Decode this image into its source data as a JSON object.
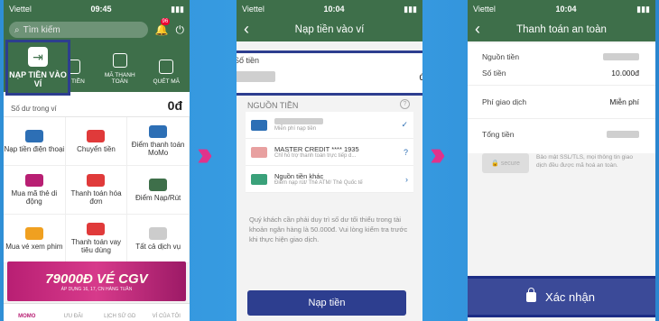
{
  "screen1": {
    "carrier": "Viettel",
    "time": "09:45",
    "battery": "▮▮▮",
    "search_placeholder": "Tìm kiếm",
    "badge": "96",
    "highlight_label": "NẠP TIỀN VÀO VÍ",
    "quick_actions": [
      {
        "label": ""
      },
      {
        "label": "ÚT TIỀN"
      },
      {
        "label": "MÃ THANH TOÁN"
      },
      {
        "label": "QUÉT MÃ"
      }
    ],
    "balance_label": "Số dư trong ví",
    "balance_value": "0đ",
    "services": [
      {
        "label": "Nạp tiền điện thoại",
        "color": "#2d6fb5"
      },
      {
        "label": "Chuyển tiền",
        "color": "#e03a3a"
      },
      {
        "label": "Điểm thanh toán MoMo",
        "color": "#2d6fb5"
      },
      {
        "label": "Mua mã thẻ di động",
        "color": "#b81f73"
      },
      {
        "label": "Thanh toán hóa đơn",
        "color": "#e03a3a"
      },
      {
        "label": "Điểm Nạp/Rút",
        "color": "#3e6f4a"
      },
      {
        "label": "Mua vé xem phim",
        "color": "#f0a020"
      },
      {
        "label": "Thanh toán vay tiêu dùng",
        "color": "#e03a3a"
      },
      {
        "label": "Tất cả dịch vụ",
        "color": "#cccccc"
      }
    ],
    "promo_big": "79000Đ VÉ CGV",
    "promo_small": "ÁP DỤNG 16, 17, CN HÀNG TUẦN",
    "tabs": [
      "MOMO",
      "ƯU ĐÃI",
      "LỊCH SỬ GD",
      "VÍ CỦA TÔI"
    ]
  },
  "screen2": {
    "carrier": "Viettel",
    "time": "10:04",
    "title": "Nạp tiền vào ví",
    "amount_label": "Số tiền",
    "currency": "đ",
    "sources_label": "NGUỒN TIỀN",
    "sources": [
      {
        "name": "",
        "sub": "Miễn phí nạp tiền",
        "mark": "✓",
        "color": "#2d6fb5"
      },
      {
        "name": "MASTER CREDIT **** 1935",
        "sub": "Chỉ hỗ trợ thanh toán trực tiếp d...",
        "mark": "?",
        "color": "#e8a0a0"
      },
      {
        "name": "Nguồn tiền khác",
        "sub": "Điểm nạp rút/ Thẻ ATM/ Thẻ Quốc tế",
        "mark": "›",
        "color": "#3aa17a"
      }
    ],
    "notice": "Quý khách cần phải duy trì số dư tối thiểu trong tài khoản ngân hàng là 50.000đ. Vui lòng kiểm tra trước khi thực hiện giao dịch.",
    "button": "Nạp tiền"
  },
  "screen3": {
    "carrier": "Viettel",
    "time": "10:04",
    "title": "Thanh toán an toàn",
    "rows": [
      {
        "label": "Nguồn tiền",
        "value": ""
      },
      {
        "label": "Số tiền",
        "value": "10.000đ"
      }
    ],
    "fee_label": "Phí giao dịch",
    "fee_value": "Miễn phí",
    "total_label": "Tổng tiền",
    "secure_logo": "secure",
    "secure_text": "Bảo mật SSL/TLS, mọi thông tin giao dịch đều được mã hoá an toàn.",
    "confirm": "Xác nhận"
  },
  "arrows": "›››"
}
